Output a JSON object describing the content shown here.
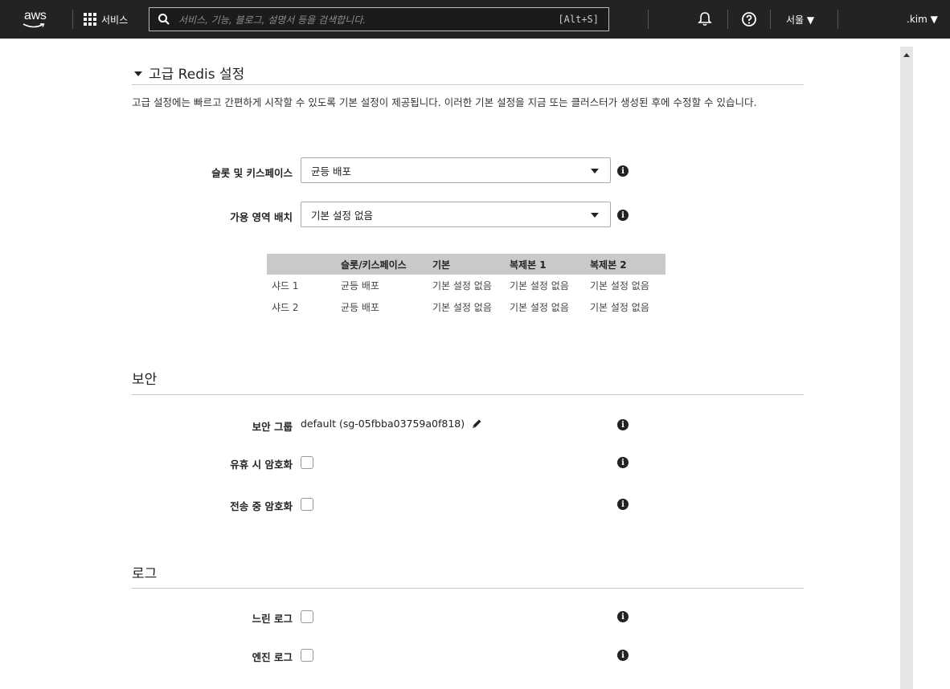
{
  "nav": {
    "logo_text": "aws",
    "services_label": "서비스",
    "search_placeholder": "서비스, 기능, 블로그, 설명서 등을 검색합니다.",
    "search_shortcut": "[Alt+S]",
    "region_label": "서울 ▼",
    "user_label": ".kim ▼"
  },
  "advanced": {
    "title": "고급 Redis 설정",
    "description": "고급 설정에는 빠르고 간편하게 시작할 수 있도록 기본 설정이 제공됩니다. 이러한 기본 설정을 지금 또는 클러스터가 생성된 후에 수정할 수 있습니다.",
    "slots_label": "슬롯 및 키스페이스",
    "slots_value": "균등 배포",
    "az_label": "가용 영역 배치",
    "az_value": "기본 설정 없음"
  },
  "shard_table": {
    "headers": [
      "",
      "슬롯/키스페이스",
      "기본",
      "복제본 1",
      "복제본 2"
    ],
    "rows": [
      [
        "샤드 1",
        "균등 배포",
        "기본 설정 없음",
        "기본 설정 없음",
        "기본 설정 없음"
      ],
      [
        "샤드 2",
        "균등 배포",
        "기본 설정 없음",
        "기본 설정 없음",
        "기본 설정 없음"
      ]
    ]
  },
  "security": {
    "title": "보안",
    "group_label": "보안 그룹",
    "group_value": "default (sg-05fbba03759a0f818)",
    "at_rest_label": "유휴 시 암호화",
    "at_rest_checked": false,
    "in_transit_label": "전송 중 암호화",
    "in_transit_checked": false
  },
  "logs": {
    "title": "로그",
    "slow_label": "느린 로그",
    "slow_checked": false,
    "engine_label": "엔진 로그",
    "engine_checked": false
  },
  "info_glyph": "i"
}
